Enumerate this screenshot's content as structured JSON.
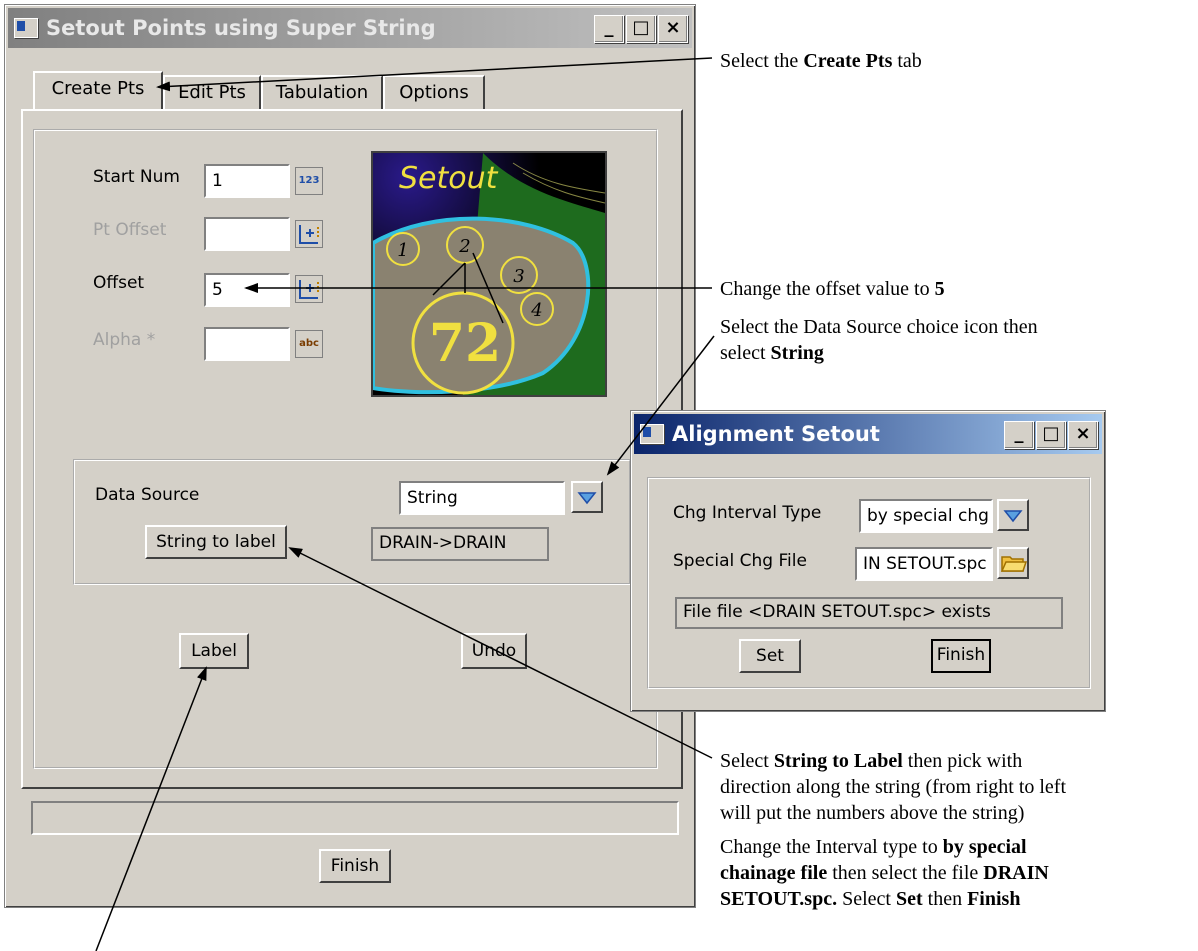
{
  "main_window": {
    "title": "Setout Points using Super String",
    "title_buttons": [
      "_",
      "□",
      "×"
    ],
    "tabs": [
      {
        "label": "Create Pts",
        "active": true
      },
      {
        "label": "Edit Pts",
        "active": false
      },
      {
        "label": "Tabulation",
        "active": false
      },
      {
        "label": "Options",
        "active": false
      }
    ],
    "fields": {
      "start_num": {
        "label": "Start Num",
        "value": "1",
        "icon_text": "123"
      },
      "pt_offset": {
        "label": "Pt Offset",
        "value": ""
      },
      "offset": {
        "label": "Offset",
        "value": "5"
      },
      "alpha": {
        "label": "Alpha *",
        "value": "",
        "icon_text": "abc"
      }
    },
    "logo": {
      "title": "Setout",
      "numbers": [
        "1",
        "2",
        "3",
        "4"
      ],
      "big_number": "72"
    },
    "data_source": {
      "label": "Data Source",
      "value": "String",
      "string_to_label_button": "String to label",
      "readout": "DRAIN->DRAIN"
    },
    "buttons": {
      "label": "Label",
      "undo": "Undo",
      "finish": "Finish"
    },
    "status_text": ""
  },
  "alignment_window": {
    "title": "Alignment Setout",
    "title_buttons": [
      "_",
      "□",
      "×"
    ],
    "chg_interval_type": {
      "label": "Chg Interval Type",
      "value": "by special chg fi"
    },
    "special_chg_file": {
      "label": "Special Chg File",
      "value": "IN SETOUT.spc"
    },
    "status": "File file <DRAIN SETOUT.spc> exists",
    "buttons": {
      "set": "Set",
      "finish": "Finish"
    }
  },
  "annotations": {
    "a1": {
      "pre": "Select the ",
      "bold": "Create Pts",
      "post": " tab"
    },
    "a2": {
      "pre": "Change the offset value to ",
      "bold": "5"
    },
    "a3": {
      "pre": "Select the Data Source choice icon then",
      "line2_pre": "select ",
      "line2_bold": "String"
    },
    "a4": {
      "p1": "Select ",
      "b1": "String to Label",
      "p2": " then pick with",
      "l2": "direction along the string (from right to left",
      "l3": "will put the numbers above the string)"
    },
    "a5": {
      "p1": "Change the Interval type to ",
      "b1": "by special",
      "b2": "chainage file",
      "p2": " then select the file ",
      "b3": "DRAIN",
      "b4": "SETOUT.spc.",
      "p3": " Select ",
      "b5": "Set",
      "p4": " then ",
      "b6": "Finish"
    }
  },
  "colors": {
    "title_active": "#0a246a",
    "title_gradient_end": "#a6caf0",
    "title_inactive": "#808080",
    "face": "#d4d0c8",
    "logo_accent": "#f0e040"
  }
}
